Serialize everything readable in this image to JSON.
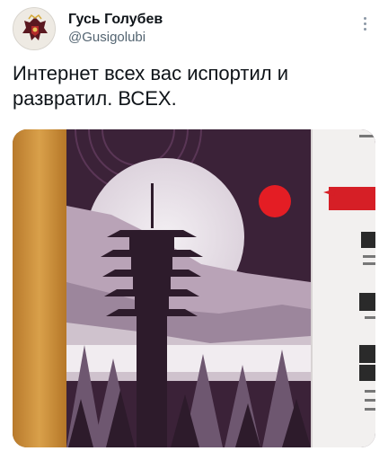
{
  "tweet": {
    "author_name": "Гусь Голубев",
    "author_handle": "@Gusigolubi",
    "text": "Интернет всех вас испортил и развратил. ВСЕХ.",
    "more_icon": "more-vertical-icon"
  },
  "media": {
    "description_icon": "photo",
    "colors": {
      "sky": "#3b2238",
      "sun_disc": "#ece6ec",
      "red_sun": "#e41d24",
      "mountain": "#9c869c",
      "pagoda": "#2d1b2b",
      "board_right": "#f2f0ef",
      "wood": "#c88c3a"
    }
  }
}
